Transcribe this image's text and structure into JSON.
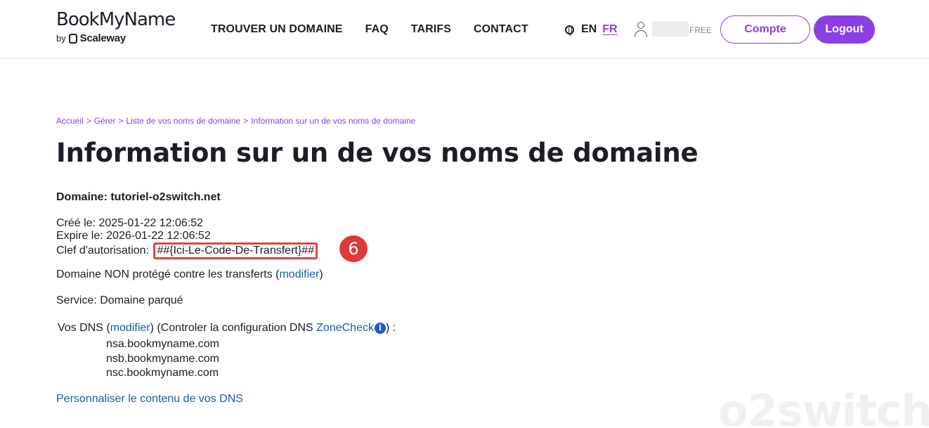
{
  "header": {
    "logo": {
      "main_thin": "Book",
      "main_bold": "MyName",
      "by": "by",
      "company": "Scaleway"
    },
    "nav": [
      "TROUVER UN DOMAINE",
      "FAQ",
      "TARIFS",
      "CONTACT"
    ],
    "lang": {
      "en": "EN",
      "fr": "FR"
    },
    "user": {
      "plan": "FREE"
    },
    "buttons": {
      "account": "Compte",
      "logout": "Logout"
    }
  },
  "breadcrumb": [
    "Accueil",
    ">",
    "Gérer",
    ">",
    "Liste de vos noms de domaine",
    ">",
    "Information sur un de vos noms de domaine"
  ],
  "page_title": "Information sur un de vos noms de domaine",
  "domain": {
    "label": "Domaine: tutoriel-o2switch.net",
    "created": "Créé le: 2025-01-22 12:06:52",
    "expires": "Expire le: 2026-01-22 12:06:52",
    "auth_label": "Clef d'autorisation:",
    "auth_code": "##{Ici-Le-Code-De-Transfert}##",
    "step": "6",
    "protection_text": "Domaine NON protégé contre les transferts (",
    "protection_link": "modifier",
    "protection_close": ")",
    "service": "Service: Domaine parqué"
  },
  "dns": {
    "label": "Vos DNS",
    "open": "(",
    "modify_link": "modifier",
    "middle": ") (Controler la configuration DNS ",
    "zonecheck_link": "ZoneCheck",
    "info_icon": "i",
    "end": ") :",
    "servers": [
      "nsa.bookmyname.com",
      "nsb.bookmyname.com",
      "nsc.bookmyname.com"
    ],
    "customize_link": "Personnaliser le contenu de vos DNS"
  },
  "watermark": "o2switch",
  "colors": {
    "accent": "#8b3ee6",
    "link": "#1a5ba8",
    "highlight": "#e0383b"
  }
}
